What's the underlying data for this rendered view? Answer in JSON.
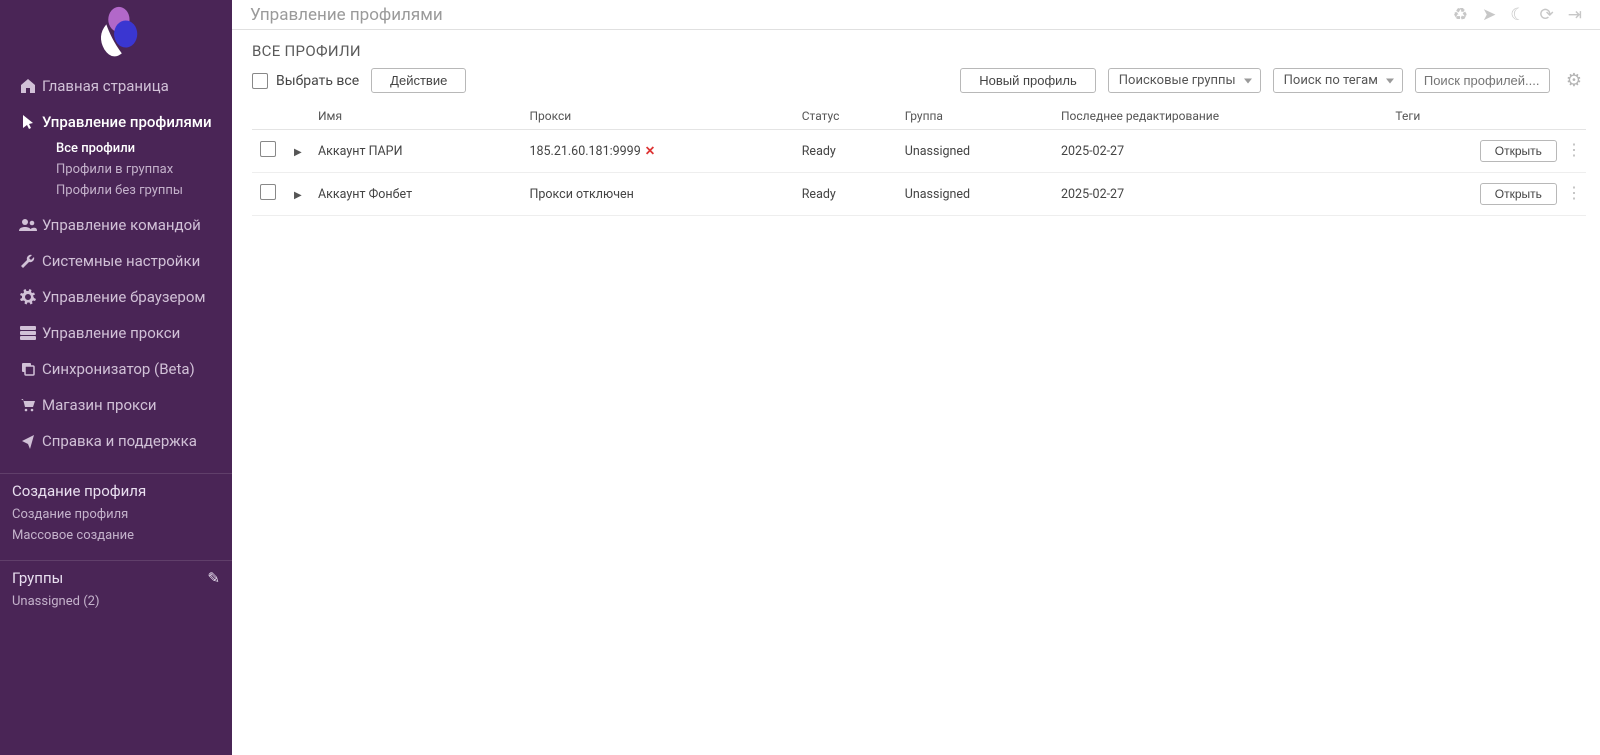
{
  "page": {
    "title": "Управление профилями",
    "section_title": "ВСЕ ПРОФИЛИ"
  },
  "sidebar": {
    "nav": [
      {
        "icon": "home",
        "label": "Главная страница",
        "active": false
      },
      {
        "icon": "cursor",
        "label": "Управление профилями",
        "active": true,
        "children": [
          {
            "label": "Все профили",
            "active": true
          },
          {
            "label": "Профили в группах",
            "active": false
          },
          {
            "label": "Профили без группы",
            "active": false
          }
        ]
      },
      {
        "icon": "team",
        "label": "Управление командой"
      },
      {
        "icon": "wrench",
        "label": "Системные настройки"
      },
      {
        "icon": "gear",
        "label": "Управление браузером"
      },
      {
        "icon": "proxy",
        "label": "Управление прокси"
      },
      {
        "icon": "sync",
        "label": "Синхронизатор (Beta)"
      },
      {
        "icon": "cart",
        "label": "Магазин прокси"
      },
      {
        "icon": "help",
        "label": "Справка и поддержка"
      }
    ],
    "sections": [
      {
        "title": "Создание профиля",
        "links": [
          {
            "label": "Создание профиля"
          },
          {
            "label": "Массовое создание"
          }
        ]
      },
      {
        "title": "Группы",
        "editable": true,
        "links": [
          {
            "label": "Unassigned (2)"
          }
        ]
      }
    ]
  },
  "toolbar": {
    "select_all_label": "Выбрать все",
    "action_label": "Действие",
    "new_profile_label": "Новый профиль",
    "groups_dropdown": "Поисковые группы",
    "tags_dropdown": "Поиск по тегам",
    "search_placeholder": "Поиск профилей...."
  },
  "table": {
    "headers": {
      "name": "Имя",
      "proxy": "Прокси",
      "status": "Статус",
      "group": "Группа",
      "last_edit": "Последнее редактирование",
      "tags": "Теги"
    },
    "open_label": "Открыть",
    "rows": [
      {
        "name": "Аккаунт ПАРИ",
        "proxy": "185.21.60.181:9999",
        "proxy_bad": true,
        "status": "Ready",
        "group": "Unassigned",
        "last_edit": "2025-02-27",
        "tags": ""
      },
      {
        "name": "Аккаунт Фонбет",
        "proxy": "Прокси отключен",
        "proxy_bad": false,
        "status": "Ready",
        "group": "Unassigned",
        "last_edit": "2025-02-27",
        "tags": ""
      }
    ]
  }
}
